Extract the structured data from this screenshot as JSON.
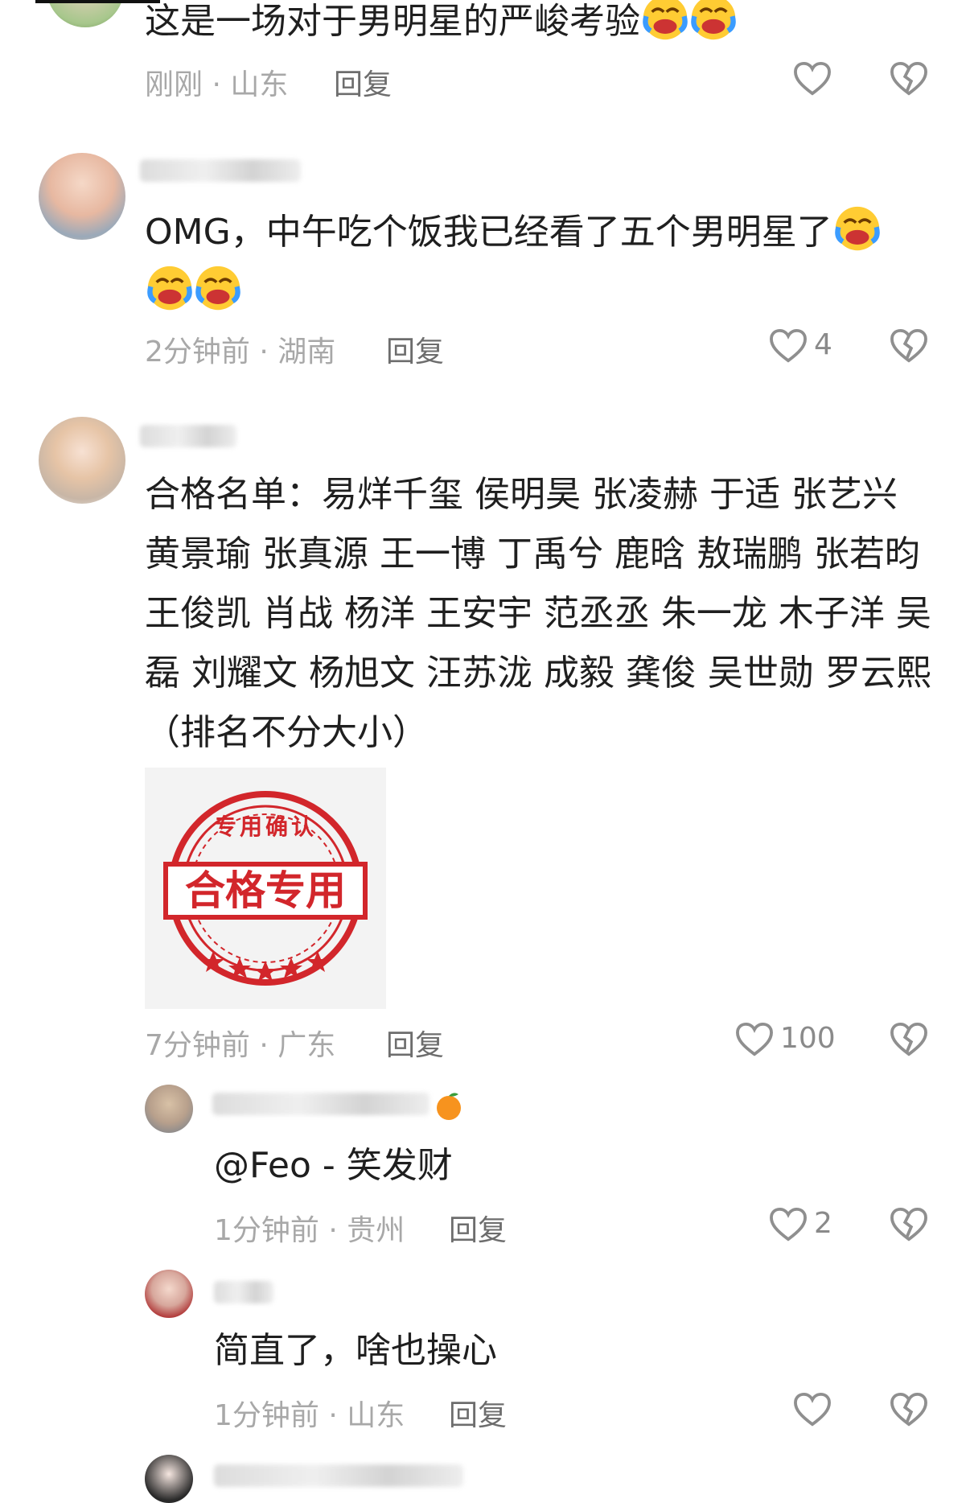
{
  "comments": [
    {
      "text": "这是一场对于男明星的严峻考验",
      "emoji_count": 2,
      "time_location": "刚刚 · 山东",
      "reply_label": "回复",
      "likes": ""
    },
    {
      "text": "OMG，中午吃个饭我已经看了五个男明星了",
      "emoji_count": 3,
      "time_location": "2分钟前 · 湖南",
      "reply_label": "回复",
      "likes": "4"
    },
    {
      "lines": [
        "合格名单：易烊千玺 侯明昊 张凌赫 于适  张艺兴",
        "黄景瑜 张真源 王一博 丁禹兮 鹿晗 敖瑞鹏 张若昀",
        "王俊凯 肖战 杨洋 王安宇 范丞丞 朱一龙  木子洋 吴",
        "磊 刘耀文 杨旭文 汪苏泷 成毅 龚俊 吴世勋 罗云熙",
        "（排名不分大小）"
      ],
      "stamp": {
        "top_text": "专用确认",
        "main_text": "合格专用"
      },
      "time_location": "7分钟前 · 广东",
      "reply_label": "回复",
      "likes": "100"
    },
    {
      "text": "@Feo  - 笑发财",
      "time_location": "1分钟前 · 贵州",
      "reply_label": "回复",
      "likes": "2"
    },
    {
      "text": "简直了，啥也操心",
      "time_location": "1分钟前 · 山东",
      "reply_label": "回复",
      "likes": ""
    }
  ],
  "colors": {
    "stamp_red": "#d2262b",
    "meta_gray": "#a8a8a8",
    "icon_gray": "#9a9a9a"
  },
  "icons": [
    "heart-icon",
    "broken-heart-icon",
    "crying-laughing-emoji",
    "orange-emoji"
  ]
}
